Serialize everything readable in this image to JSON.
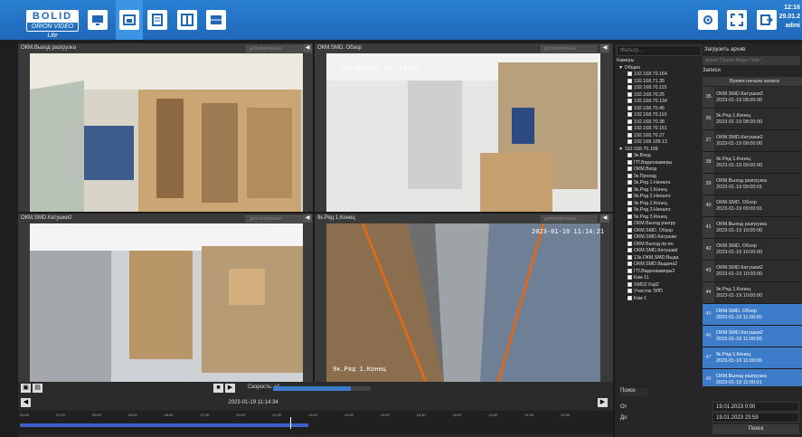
{
  "app": {
    "logo_line1": "BOLID",
    "logo_line2": "ORION VIDEO Lite"
  },
  "clock": {
    "time": "12:16",
    "date": "29.01.2",
    "user": "admi"
  },
  "toolbar": {
    "icons": [
      "monitor-icon",
      "camera-icon",
      "document-icon",
      "layout-icon",
      "grid-icon"
    ],
    "right_icons": [
      "settings-icon",
      "fullscreen-icon",
      "exit-icon"
    ]
  },
  "cells": [
    {
      "title": "ОКМ.Выход разгрузка",
      "dropdown": "дополнительно"
    },
    {
      "title": "ОКМ.SMD. Обзор",
      "dropdown": "дополнительно",
      "osd": "01/19/2023 Thu 11:14"
    },
    {
      "title": "ОКМ.SMD.Катушки2",
      "dropdown": "дополнительно"
    },
    {
      "title": "9к.Ряд 1.Конец",
      "dropdown": "дополнительно",
      "osd": "2023-01-19 11:14:21",
      "osd2": "9к.Ряд 1.Конец"
    }
  ],
  "right_panel": {
    "filter_placeholder": "Фильтр...",
    "tree_header": "Камеры",
    "tree": [
      {
        "label": "Общие",
        "level": 0,
        "cb": false,
        "expander": true
      },
      {
        "label": "192.168.70.164",
        "level": 1,
        "cb": true,
        "on": false
      },
      {
        "label": "192.168.71.35",
        "level": 1,
        "cb": true,
        "on": false
      },
      {
        "label": "192.168.70.115",
        "level": 1,
        "cb": true,
        "on": false
      },
      {
        "label": "192.168.70.25",
        "level": 1,
        "cb": true,
        "on": false
      },
      {
        "label": "192.168.70.134",
        "level": 1,
        "cb": true,
        "on": false
      },
      {
        "label": "192.168.70.46",
        "level": 1,
        "cb": true,
        "on": false
      },
      {
        "label": "192.168.70.110",
        "level": 1,
        "cb": true,
        "on": false
      },
      {
        "label": "192.168.70.38",
        "level": 1,
        "cb": true,
        "on": false
      },
      {
        "label": "192.168.70.151",
        "level": 1,
        "cb": true,
        "on": false
      },
      {
        "label": "192.168.70.27",
        "level": 1,
        "cb": true,
        "on": false
      },
      {
        "label": "192.168.109.13",
        "level": 1,
        "cb": true,
        "on": false
      },
      {
        "label": "192.168.70.108",
        "level": 0,
        "cb": false,
        "expander": true
      },
      {
        "label": "9к.Вход",
        "level": 1,
        "cb": true,
        "on": false
      },
      {
        "label": "ГП.Видеокамеры",
        "level": 1,
        "cb": true,
        "on": false
      },
      {
        "label": "ОКМ.Вход",
        "level": 1,
        "cb": true,
        "on": false
      },
      {
        "label": "9к.Проход",
        "level": 1,
        "cb": true,
        "on": false
      },
      {
        "label": "9к.Ряд 1.Начало",
        "level": 1,
        "cb": true,
        "on": false
      },
      {
        "label": "9к.Ряд 1.Конец",
        "level": 1,
        "cb": true,
        "on": true
      },
      {
        "label": "9к.Ряд 2.Начало",
        "level": 1,
        "cb": true,
        "on": false
      },
      {
        "label": "9к.Ряд 2.Конец",
        "level": 1,
        "cb": true,
        "on": false
      },
      {
        "label": "9к.Ряд 3.Начало",
        "level": 1,
        "cb": true,
        "on": false
      },
      {
        "label": "9к.Ряд 3.Конец",
        "level": 1,
        "cb": true,
        "on": false
      },
      {
        "label": "ОКМ.Выход разгру",
        "level": 1,
        "cb": true,
        "on": true
      },
      {
        "label": "ОКМ.SMD. Обзор",
        "level": 1,
        "cb": true,
        "on": true
      },
      {
        "label": "ОКМ.SMD.Катушки",
        "level": 1,
        "cb": true,
        "on": false
      },
      {
        "label": "ОКМ.Выход пр-во",
        "level": 1,
        "cb": true,
        "on": false
      },
      {
        "label": "ОКМ.SMD.Катушкиl",
        "level": 1,
        "cb": true,
        "on": true
      },
      {
        "label": "13к.ОКМ.SMD.Выда",
        "level": 1,
        "cb": true,
        "on": false
      },
      {
        "label": "ОКМ.SMD.Выдача2",
        "level": 1,
        "cb": true,
        "on": false
      },
      {
        "label": "ГП.Видеокамеры2",
        "level": 1,
        "cb": true,
        "on": false
      },
      {
        "label": "Кам 11",
        "level": 1,
        "cb": true,
        "on": false
      },
      {
        "label": "SMD2 Fuji2",
        "level": 1,
        "cb": true,
        "on": false
      },
      {
        "label": "Участок ЭЛП",
        "level": 1,
        "cb": true,
        "on": false
      },
      {
        "label": "Кам 1",
        "level": 1,
        "cb": true,
        "on": false
      }
    ],
    "records_button": "Загрузить архив",
    "records_select": "Архив \"Орион Видео Лайт\"",
    "records_label": "Записи",
    "records_header": "Время начала записи",
    "records": [
      {
        "num": "35",
        "title": "ОКМ.SMD.Катушки2",
        "time": "2023-01-19 08:00:00",
        "sel": false
      },
      {
        "num": "36",
        "title": "9к.Ряд 1.Конец",
        "time": "2023-01-19 08:00:00",
        "sel": false
      },
      {
        "num": "37",
        "title": "ОКМ.SMD.Катушки2",
        "time": "2023-01-19 09:00:00",
        "sel": false
      },
      {
        "num": "38",
        "title": "9к.Ряд 1.Конец",
        "time": "2023-01-19 09:00:00",
        "sel": false
      },
      {
        "num": "39",
        "title": "ОКМ.Выход разгрузка",
        "time": "2023-01-19 09:00:01",
        "sel": false
      },
      {
        "num": "40",
        "title": "ОКМ.SMD. Обзор",
        "time": "2023-01-19 09:00:01",
        "sel": false
      },
      {
        "num": "41",
        "title": "ОКМ.Выход разгрузка",
        "time": "2023-01-19 10:00:00",
        "sel": false
      },
      {
        "num": "42",
        "title": "ОКМ.SMD. Обзор",
        "time": "2023-01-19 10:00:00",
        "sel": false
      },
      {
        "num": "43",
        "title": "ОКМ.SMD.Катушки2",
        "time": "2023-01-19 10:00:00",
        "sel": false
      },
      {
        "num": "44",
        "title": "9к.Ряд 1.Конец",
        "time": "2023-01-19 10:00:00",
        "sel": false
      },
      {
        "num": "45",
        "title": "ОКМ.SMD. Обзор",
        "time": "2023-01-19 11:00:00",
        "sel": true
      },
      {
        "num": "46",
        "title": "ОКМ.SMD.Катушки2",
        "time": "2023-01-19 11:00:00",
        "sel": true
      },
      {
        "num": "47",
        "title": "9к.Ряд 1.Конец",
        "time": "2023-01-19 11:00:00",
        "sel": true
      },
      {
        "num": "48",
        "title": "ОКМ.Выход разгрузка",
        "time": "2023-01-19 11:00:01",
        "sel": true
      },
      {
        "num": "",
        "title": "9к.Ряд 1.Конец",
        "time": "",
        "sel": false
      }
    ]
  },
  "search": {
    "tab": "Поиск",
    "from_label": "От",
    "to_label": "До",
    "from_value": "19.01.2023 0:00",
    "to_value": "19.01.2023 23:59",
    "button": "Поиск"
  },
  "player": {
    "speed_label": "Скорость: x1",
    "speed_level": 0.8,
    "current_time": "2023-01-19 11:14:34",
    "ticks": [
      "00:00",
      "01:30",
      "03:00",
      "04:30",
      "06:00",
      "07:30",
      "09:00",
      "10:30",
      "12:00",
      "13:30",
      "15:00",
      "16:30",
      "18:00",
      "19:30",
      "21:00",
      "22:30"
    ],
    "recorded_until": "12:00",
    "cursor": "11:14"
  }
}
